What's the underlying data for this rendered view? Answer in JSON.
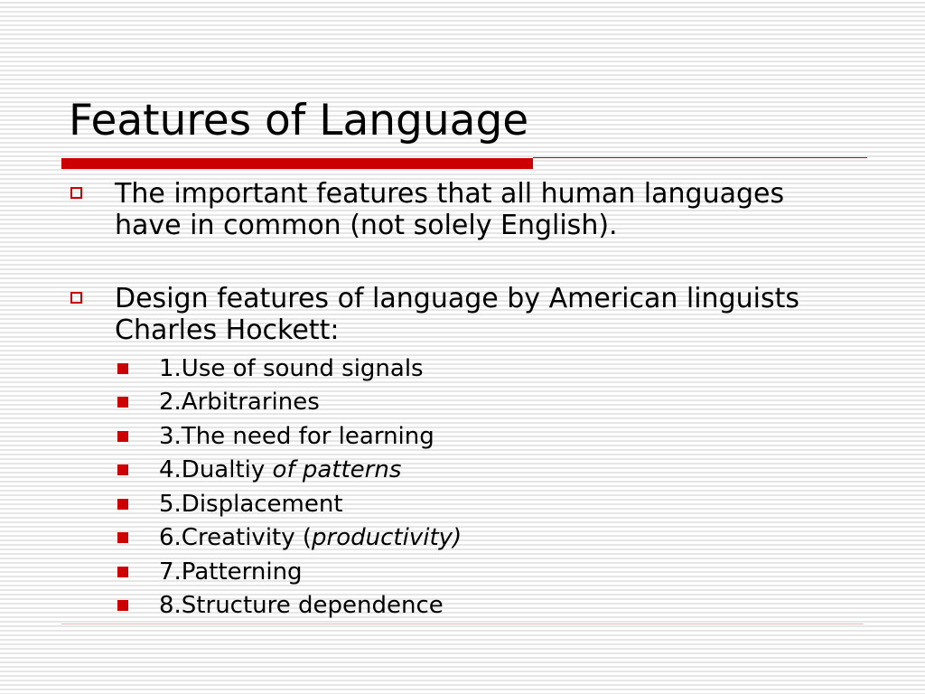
{
  "slide": {
    "title": "Features of Language",
    "accent_color": "#cc0000",
    "bullets": [
      {
        "text": "The important features that all human languages have in common (not solely English)."
      },
      {
        "text": "Design features of language by American linguists Charles Hockett:"
      }
    ],
    "sub_bullets": [
      {
        "text": "1.Use of sound signals",
        "italic": ""
      },
      {
        "text": "2.Arbitrarines",
        "italic": ""
      },
      {
        "text": "3.The need for learning",
        "italic": ""
      },
      {
        "text": "4.Dualtiy ",
        "italic": "of patterns"
      },
      {
        "text": "5.Displacement",
        "italic": ""
      },
      {
        "text": "6.Creativity (",
        "italic": "productivity)"
      },
      {
        "text": "7.Patterning",
        "italic": ""
      },
      {
        "text": "8.Structure dependence",
        "italic": ""
      }
    ]
  }
}
